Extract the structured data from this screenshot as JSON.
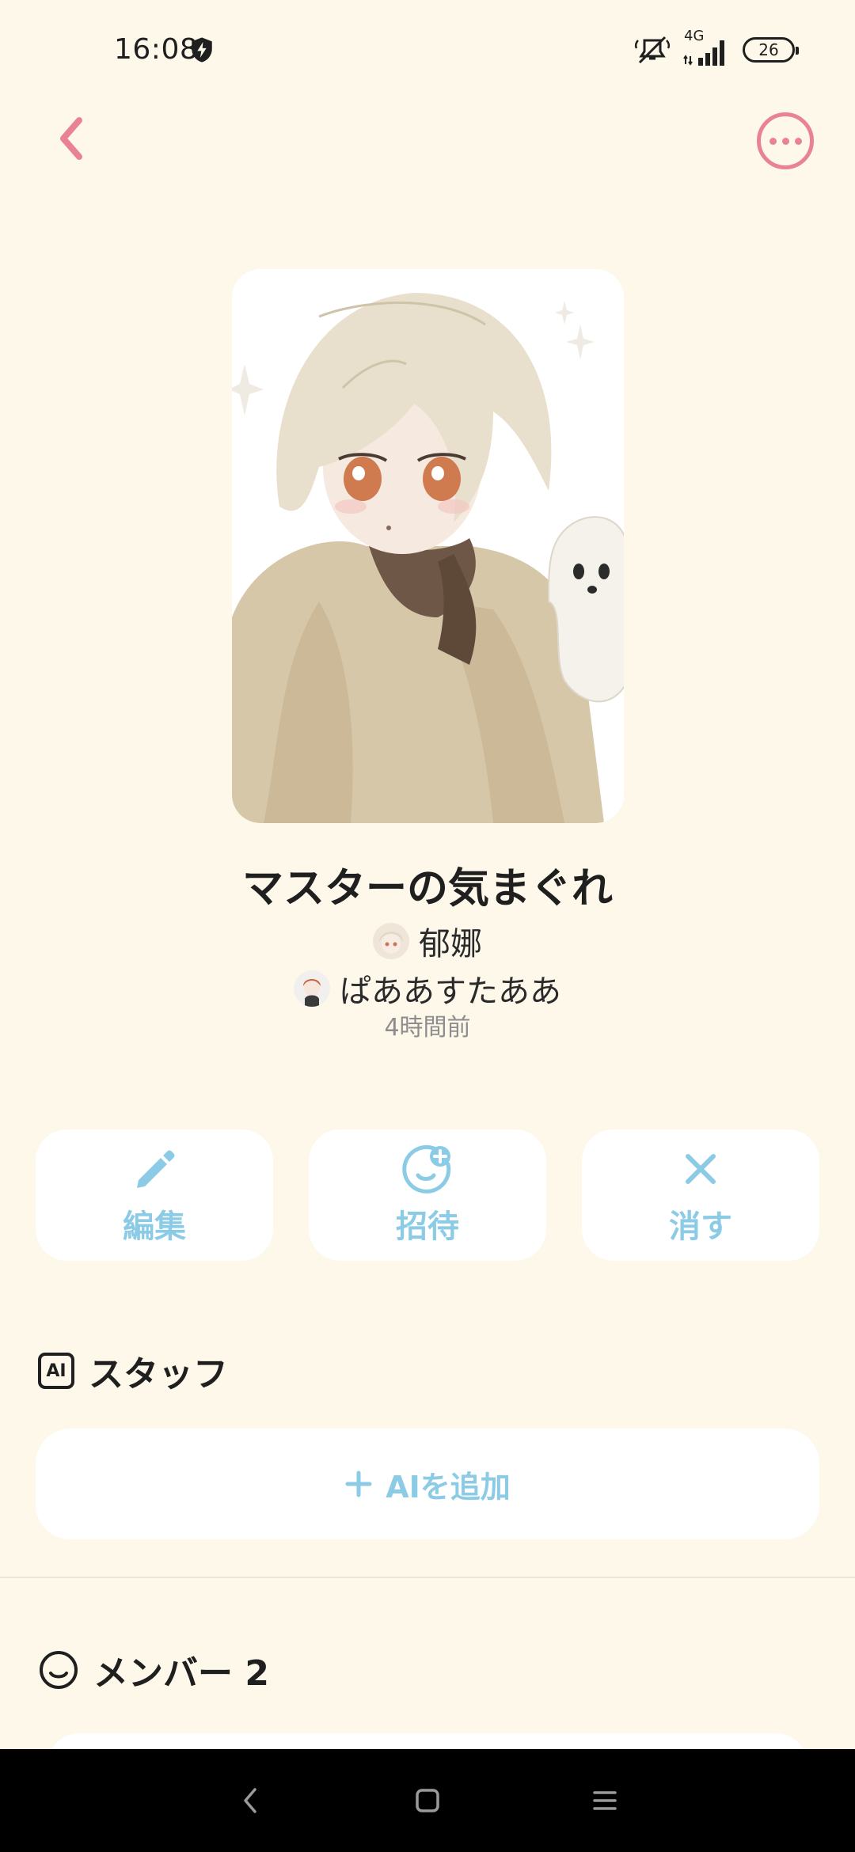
{
  "status_bar": {
    "time": "16:08",
    "network": "4G",
    "battery": "26",
    "icons": [
      "shield-icon",
      "mute-icon",
      "signal-icon",
      "battery-icon"
    ]
  },
  "header": {
    "back_icon": "chevron-left-icon",
    "more_icon": "more-horizontal-icon",
    "accent_color": "#E98294"
  },
  "room": {
    "title": "マスターの気まぐれ",
    "owner": "郁娜",
    "creator": "ぱああすたああ",
    "time_ago": "4時間前"
  },
  "actions": [
    {
      "label": "編集",
      "icon": "pencil-icon"
    },
    {
      "label": "招待",
      "icon": "invite-icon"
    },
    {
      "label": "消す",
      "icon": "close-icon"
    }
  ],
  "staff": {
    "heading": "スタッフ",
    "badge": "AI",
    "add_label": "AIを追加"
  },
  "members": {
    "heading": "メンバー 2"
  },
  "colors": {
    "background": "#FDF8EA",
    "action_blue": "#8CCBE6",
    "card": "#FFFFFF"
  }
}
